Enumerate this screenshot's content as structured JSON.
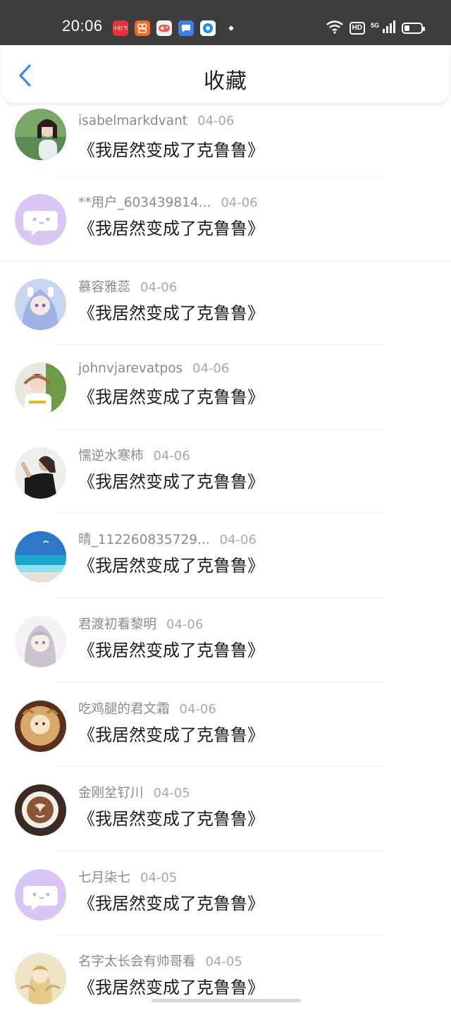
{
  "status_bar": {
    "time": "20:06",
    "apps": [
      "小红书",
      "快手",
      "game",
      "message",
      "browser"
    ],
    "hd_label": "HD",
    "network_label": "5G",
    "battery_level": 0.3
  },
  "nav": {
    "title": "收藏",
    "back_icon": "chevron-left-icon",
    "accent_color": "#2f8ee8"
  },
  "favorites": [
    {
      "user": "isabelmarkdvant",
      "date": "04-06",
      "content": "《我居然变成了克鲁鲁》"
    },
    {
      "user": "**用户_603439814...",
      "date": "04-06",
      "content": "《我居然变成了克鲁鲁》"
    },
    {
      "user": "慕容雅蕊",
      "date": "04-06",
      "content": "《我居然变成了克鲁鲁》"
    },
    {
      "user": "johnvjarevatpos",
      "date": "04-06",
      "content": "《我居然变成了克鲁鲁》"
    },
    {
      "user": "懦逆水寒柿",
      "date": "04-06",
      "content": "《我居然变成了克鲁鲁》"
    },
    {
      "user": "晴_112260835729...",
      "date": "04-06",
      "content": "《我居然变成了克鲁鲁》"
    },
    {
      "user": "君渡初看黎明",
      "date": "04-06",
      "content": "《我居然变成了克鲁鲁》"
    },
    {
      "user": "吃鸡腿的君文霜",
      "date": "04-06",
      "content": "《我居然变成了克鲁鲁》"
    },
    {
      "user": "金刚坌钌川",
      "date": "04-05",
      "content": "《我居然变成了克鲁鲁》"
    },
    {
      "user": "七月柒七",
      "date": "04-05",
      "content": "《我居然变成了克鲁鲁》"
    },
    {
      "user": "名字太长会有帅哥看",
      "date": "04-05",
      "content": "《我居然变成了克鲁鲁》"
    }
  ]
}
